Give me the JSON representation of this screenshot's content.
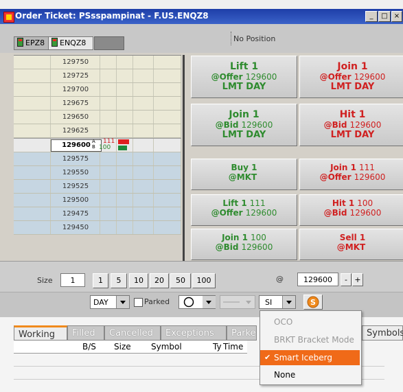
{
  "window": {
    "title": "Order Ticket: PSsspampinat - F.US.ENQZ8",
    "minimize": "_",
    "restore": "□",
    "close": "×"
  },
  "contract_tabs": [
    {
      "label": "EPZ8"
    },
    {
      "label": "ENQZ8"
    }
  ],
  "position_text": "No Position",
  "ladder": {
    "rows": [
      {
        "price": "129750"
      },
      {
        "price": "129725"
      },
      {
        "price": "129700"
      },
      {
        "price": "129675"
      },
      {
        "price": "129650"
      },
      {
        "price": "129625"
      },
      {
        "price": "129600"
      },
      {
        "price": "129575"
      },
      {
        "price": "129550"
      },
      {
        "price": "129525"
      },
      {
        "price": "129500"
      },
      {
        "price": "129475"
      },
      {
        "price": "129450"
      }
    ],
    "ask_size": "111",
    "bid_size": "100",
    "ab_label": "A B"
  },
  "order_buttons": [
    {
      "line1": "Lift 1",
      "line2a": "@Offer",
      "line2b": "129600",
      "line3": "LMT DAY",
      "color": "#2e8b2e"
    },
    {
      "line1": "Join 1",
      "line2a": "@Offer",
      "line2b": "129600",
      "line3": "LMT DAY",
      "color": "#d02020"
    },
    {
      "line1": "Join 1",
      "line2a": "@Bid",
      "line2b": "129600",
      "line3": "LMT DAY",
      "color": "#2e8b2e"
    },
    {
      "line1": "Hit 1",
      "line2a": "@Bid",
      "line2b": "129600",
      "line3": "LMT DAY",
      "color": "#d02020"
    },
    {
      "line1": "Buy 1",
      "line2a": "@MKT",
      "line2b": "",
      "line3": "",
      "color": "#2e8b2e"
    },
    {
      "line1": "Join 1",
      "line1b": "111",
      "line2a": "@Offer",
      "line2b": "129600",
      "color": "#d02020"
    },
    {
      "line1": "Lift 1",
      "line1b": "111",
      "line2a": "@Offer",
      "line2b": "129600",
      "color": "#2e8b2e"
    },
    {
      "line1": "Hit 1",
      "line1b": "100",
      "line2a": "@Bid",
      "line2b": "129600",
      "color": "#d02020"
    },
    {
      "line1": "Join 1",
      "line1b": "100",
      "line2a": "@Bid",
      "line2b": "129600",
      "color": "#2e8b2e"
    },
    {
      "line1": "Sell 1",
      "line2a": "@MKT",
      "line2b": "",
      "color": "#d02020"
    }
  ],
  "size_bar": {
    "size_label": "Size",
    "size_value": "1",
    "presets": [
      "1",
      "5",
      "10",
      "20",
      "50",
      "100"
    ],
    "at_label": "@",
    "price_value": "129600",
    "minus": "-",
    "plus": "+"
  },
  "options_bar": {
    "tif_value": "DAY",
    "parked_label": "Parked",
    "algo_value": "SI"
  },
  "order_tabs": [
    "Working",
    "Filled",
    "Cancelled",
    "Exceptions",
    "Parke"
  ],
  "symbols_tab": "Symbols",
  "grid_columns": [
    "B/S",
    "Size",
    "Symbol",
    "Ty",
    "Time"
  ],
  "algo_menu": {
    "items": [
      {
        "label": "OCO",
        "enabled": false
      },
      {
        "label": "BRKT Bracket Mode",
        "enabled": false
      },
      {
        "label": "Smart Iceberg",
        "selected": true
      },
      {
        "label": "None",
        "enabled": true
      }
    ]
  }
}
